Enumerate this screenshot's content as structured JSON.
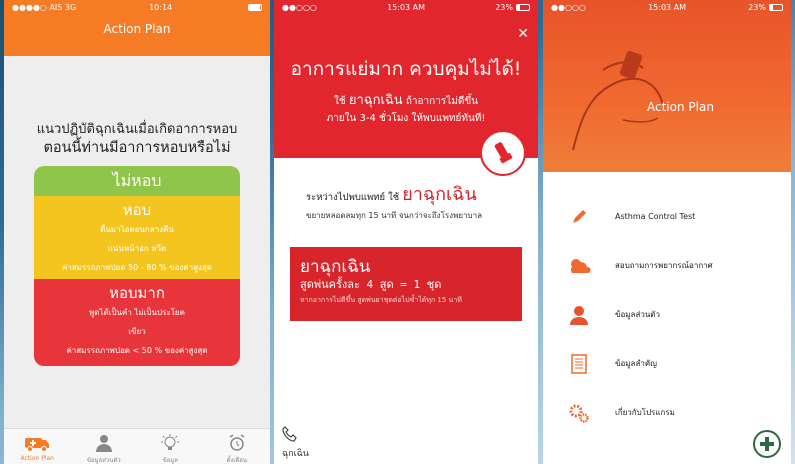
{
  "screen1": {
    "status": {
      "carrier": "●●●●○ AIS  3G",
      "time": "10:14"
    },
    "nav_title": "Action Plan",
    "question_line1": "แนวปฏิบัติฉุกเฉินเมื่อเกิดอาการหอบ",
    "question_line2": "ตอนนี้ท่านมีอาการหอบหรือไม่",
    "zone_green": {
      "title": "ไม่หอบ",
      "color": "#8fc54a"
    },
    "zone_yellow": {
      "title": "หอบ",
      "lines": [
        "ตื่นมาไอตอนกลางคืน",
        "แน่นหน้าอก หวีด",
        "ค่าสมรรถภาพปอด 50 - 80 % ของค่าสูงสุด"
      ],
      "color": "#f4c51f"
    },
    "zone_red": {
      "title": "หอบมาก",
      "lines": [
        "พูดได้เป็นคำ ไม่เป็นประโยค",
        "เขียว",
        "ค่าสมรรถภาพปอด < 50 % ของค่าสูงสุด"
      ],
      "color": "#e8353b"
    },
    "tabs": [
      {
        "label": "Action Plan",
        "icon": "ambulance-icon"
      },
      {
        "label": "ข้อมูลส่วนตัว",
        "icon": "person-icon"
      },
      {
        "label": "ข้อมูล",
        "icon": "lightbulb-icon"
      },
      {
        "label": "ตั้งเตือน",
        "icon": "alarm-clock-icon"
      }
    ]
  },
  "screen2": {
    "status": {
      "carrier": "●●○○○",
      "time": "15:03 AM",
      "battery": "23%"
    },
    "title": "อาการแย่มาก ควบคุมไม่ได้!",
    "sub_line1_a": "ใช้ ",
    "sub_line1_b": "ยาฉุกเฉิน",
    "sub_line1_c": " ถ้าอาการไม่ดีขึ้น",
    "sub_line2": "ภายใน 3-4 ชั่วโมง ให้พบแพทย์ทันที!",
    "hospital_a": "ระหว่างไปพบแพทย์ ใช้ ",
    "hospital_b": "ยาฉุกเฉิน",
    "hospital_c": "ขยายหลอดลมทุก 15 นาที จนกว่าจะถึงโรงพยาบาล",
    "card_title": "ยาฉุกเฉิน",
    "card_dose": "สูดพ่นครั้งละ 4 สูด = 1 ชุด",
    "card_note": "หากอาการไม่ดีขึ้น สูดพ่นยาชุดต่อไปซ้ำได้ทุก 15 นาที",
    "call_label": "ฉุกเฉิน",
    "accent": "#e1262d"
  },
  "screen3": {
    "status": {
      "carrier": "●●○○○",
      "time": "15:03 AM",
      "battery": "23%"
    },
    "hero_title": "Action Plan",
    "menu": [
      {
        "label": "Asthma Control Test",
        "icon": "pencil-icon"
      },
      {
        "label": "สอบถามการพยากรณ์อากาศ",
        "icon": "weather-icon"
      },
      {
        "label": "ข้อมูลส่วนตัว",
        "icon": "person-icon"
      },
      {
        "label": "ข้อมูลสำคัญ",
        "icon": "document-icon"
      },
      {
        "label": "เกี่ยวกับโปรแกรม",
        "icon": "gears-icon"
      }
    ],
    "accent": "#f06a30"
  }
}
